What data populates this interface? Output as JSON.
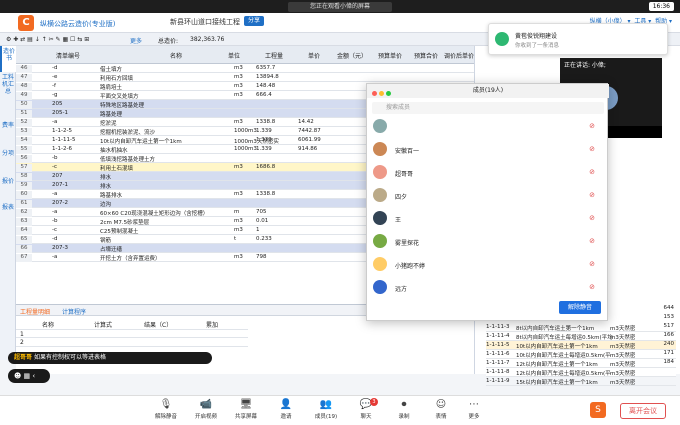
{
  "meeting_bar": {
    "title": "您正在观看小偉的屏幕",
    "time": "16:36"
  },
  "app": {
    "name": "纵横公路云造价(专业版)",
    "project": "新县环山道口接线工程",
    "share": "分享",
    "user": "纵横（小偉）",
    "tools": "工具",
    "help": "帮助"
  },
  "toolbar": {
    "more": "更多",
    "total_label": "总造价:",
    "total_value": "382,363.76"
  },
  "sidenav": [
    "造价书",
    "工料机汇总",
    "费率",
    "分项",
    "报价",
    "报表"
  ],
  "grid": {
    "headers": [
      "清单编号",
      "名称",
      "单位",
      "工程量",
      "单价",
      "金额（元）",
      "预算单价",
      "预算合价",
      "调价后单价"
    ],
    "rows": [
      {
        "n": "46",
        "code": "-d",
        "name": "借土填方",
        "unit": "m3",
        "qty": "6357.7",
        "price": "",
        "s": false
      },
      {
        "n": "47",
        "code": "-e",
        "name": "利用石方回填",
        "unit": "m3",
        "qty": "13894.8",
        "price": "",
        "s": false
      },
      {
        "n": "48",
        "code": "-f",
        "name": "路肩培土",
        "unit": "m3",
        "qty": "148.48",
        "price": "",
        "s": false
      },
      {
        "n": "49",
        "code": "-g",
        "name": "平面交叉处填方",
        "unit": "m3",
        "qty": "666.4",
        "price": "",
        "s": false
      },
      {
        "n": "50",
        "code": "205",
        "name": "特殊地区路基处理",
        "unit": "",
        "qty": "",
        "price": "",
        "s": true
      },
      {
        "n": "51",
        "code": "205-1",
        "name": "路基处理",
        "unit": "",
        "qty": "",
        "price": "",
        "s": true
      },
      {
        "n": "52",
        "code": "-a",
        "name": "挖淤泥",
        "unit": "m3",
        "qty": "1338.8",
        "price": "14.42",
        "s": false
      },
      {
        "n": "53",
        "code": "1-1-2-5",
        "name": "挖掘机挖装淤泥、流沙",
        "unit": "1000m3",
        "qty": "1.339",
        "price": "7442.87",
        "s": false
      },
      {
        "n": "54",
        "code": "1-1-11-5",
        "name": "10t以内自卸汽车运土第一个1km",
        "unit": "1000m3天然密实",
        "qty": "1.339",
        "price": "6061.99",
        "s": false
      },
      {
        "n": "55",
        "code": "1-1-2-6",
        "name": "抽水机抽水",
        "unit": "1000m3",
        "qty": "1.339",
        "price": "914.86",
        "s": false
      },
      {
        "n": "56",
        "code": "-b",
        "name": "低填浅挖路基处理土方",
        "unit": "",
        "qty": "",
        "price": "",
        "s": false
      },
      {
        "n": "57",
        "code": "-c",
        "name": "利用土石混填",
        "unit": "m3",
        "qty": "1686.8",
        "price": "",
        "s": false,
        "sel": true
      },
      {
        "n": "58",
        "code": "207",
        "name": "排水",
        "unit": "",
        "qty": "",
        "price": "",
        "s": true
      },
      {
        "n": "59",
        "code": "207-1",
        "name": "排水",
        "unit": "",
        "qty": "",
        "price": "",
        "s": true
      },
      {
        "n": "60",
        "code": "-a",
        "name": "路基排水",
        "unit": "m3",
        "qty": "1338.8",
        "price": "",
        "s": false
      },
      {
        "n": "61",
        "code": "207-2",
        "name": "边沟",
        "unit": "",
        "qty": "",
        "price": "",
        "s": true
      },
      {
        "n": "62",
        "code": "-a",
        "name": "60×60 C20现浇混凝土矩形边沟（含挖槽）",
        "unit": "m",
        "qty": "705",
        "price": "",
        "s": false
      },
      {
        "n": "63",
        "code": "-b",
        "name": "2cm M7.5砂浆垫层",
        "unit": "m3",
        "qty": "0.01",
        "price": "",
        "s": false
      },
      {
        "n": "64",
        "code": "-c",
        "name": "C25预制混凝土",
        "unit": "m3",
        "qty": "1",
        "price": "",
        "s": false
      },
      {
        "n": "65",
        "code": "-d",
        "name": "钢筋",
        "unit": "t",
        "qty": "0.233",
        "price": "",
        "s": false
      },
      {
        "n": "66",
        "code": "207-3",
        "name": "占壕迁缮",
        "unit": "",
        "qty": "",
        "price": "",
        "s": true
      },
      {
        "n": "67",
        "code": "-a",
        "name": "开挖土方（含弃置运费）",
        "unit": "m3",
        "qty": "798",
        "price": "",
        "s": false
      }
    ]
  },
  "bottom_panel": {
    "tabs": [
      "工程量明细",
      "计算程序"
    ],
    "headers": [
      "名称",
      "计算式",
      "结果（C）",
      "累加"
    ]
  },
  "right_panel": {
    "col_header": "基价",
    "prices": [
      "644",
      "153",
      "517",
      "166",
      "240",
      "171",
      "184"
    ],
    "rows": [
      {
        "code": "1-1-11-3",
        "name": "8t以内自卸汽车运土第一个1km",
        "unit": "m3天然密"
      },
      {
        "code": "1-1-11-4",
        "name": "8t以内自卸汽车运土每增运0.5km(平均",
        "unit": "m3天然密"
      },
      {
        "code": "1-1-11-5",
        "name": "10t以内自卸汽车运土第一个1km",
        "unit": "m3天然密"
      },
      {
        "code": "1-1-11-6",
        "name": "10t以内自卸汽车运土每增运0.5km(平",
        "unit": "m3天然密"
      },
      {
        "code": "1-1-11-7",
        "name": "12t以内自卸汽车运土第一个1km",
        "unit": "m3天然密"
      },
      {
        "code": "1-1-11-8",
        "name": "12t以内自卸汽车运土每增运0.5km(平",
        "unit": "m3天然密"
      },
      {
        "code": "1-1-11-9",
        "name": "15t以内自卸汽车运土第一个1km",
        "unit": "m3天然密"
      }
    ]
  },
  "members": {
    "title": "成员(19人)",
    "search_placeholder": "搜索成员",
    "unmute": "解除静音",
    "list": [
      {
        "name": ""
      },
      {
        "name": "安徽百一"
      },
      {
        "name": "超哥哥"
      },
      {
        "name": "四夕"
      },
      {
        "name": "王"
      },
      {
        "name": "雾里探花"
      },
      {
        "name": "小猪跑不婷"
      },
      {
        "name": "远方"
      }
    ]
  },
  "notification": {
    "title": "黄苞俊锐翔建设",
    "body": "你收到了一条消息"
  },
  "video": {
    "speaking": "正在讲话: 小偉;",
    "name": "小偉"
  },
  "toast": {
    "user": "超哥哥",
    "text": "如果有控制权可以等进表格"
  },
  "bottom_bar": {
    "buttons": [
      "解除静音",
      "开启视频",
      "共享屏幕",
      "邀请",
      "成员(19)",
      "聊天",
      "录制",
      "表情",
      "更多"
    ],
    "chat_badge": "3",
    "leave": "离开会议"
  },
  "colors": {
    "accent": "#1f6fc5",
    "header_row": "#d4dcf0",
    "selected_row": "#fff6c8",
    "danger": "#e05050"
  }
}
